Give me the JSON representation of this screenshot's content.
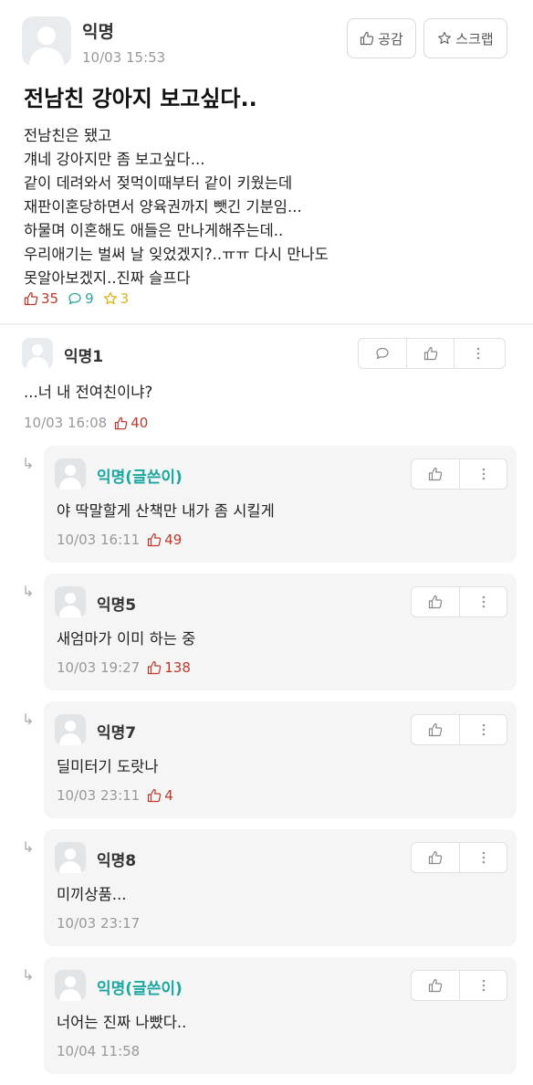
{
  "post": {
    "author": "익명",
    "date": "10/03 15:53",
    "like_button": "공감",
    "scrap_button": "스크랩",
    "title": "전남친 강아지 보고싶다..",
    "body_lines": [
      "전남친은 됐고",
      "걔네 강아지만 좀 보고싶다...",
      "같이 데려와서 젖먹이때부터 같이 키웠는데",
      "재판이혼당하면서 양육권까지 뺏긴 기분임...",
      "하물며 이혼해도 애들은 만나게해주는데..",
      "우리애기는 벌써 날 잊었겠지?..ㅠㅠ 다시 만나도",
      "못알아보겠지..진짜 슬프다"
    ],
    "stats": {
      "likes": "35",
      "comments": "9",
      "scraps": "3"
    }
  },
  "comments": [
    {
      "author": "익명1",
      "text": "...너 내 전여친이냐?",
      "date": "10/03 16:08",
      "likes": "40"
    }
  ],
  "replies": [
    {
      "author": "익명(글쓴이)",
      "is_writer": true,
      "text": "야 딱말할게 산책만 내가 좀 시킬게",
      "date": "10/03 16:11",
      "likes": "49"
    },
    {
      "author": "익명5",
      "is_writer": false,
      "text": "새엄마가 이미 하는 중",
      "date": "10/03 19:27",
      "likes": "138"
    },
    {
      "author": "익명7",
      "is_writer": false,
      "text": "딜미터기 도랏나",
      "date": "10/03 23:11",
      "likes": "4"
    },
    {
      "author": "익명8",
      "is_writer": false,
      "text": "미끼상품...",
      "date": "10/03 23:17",
      "likes": ""
    },
    {
      "author": "익명(글쓴이)",
      "is_writer": true,
      "text": "너어는 진짜 나빴다..",
      "date": "10/04 11:58",
      "likes": ""
    }
  ],
  "colors": {
    "like": "#c0392b",
    "comment": "#2aa6a0",
    "scrap": "#e0b21a",
    "writer": "#19a7a0"
  },
  "icons": {
    "like": "thumbs-up-icon",
    "comment": "speech-bubble-icon",
    "scrap": "star-icon",
    "more": "kebab-menu-icon",
    "reply": "reply-arrow-icon"
  }
}
